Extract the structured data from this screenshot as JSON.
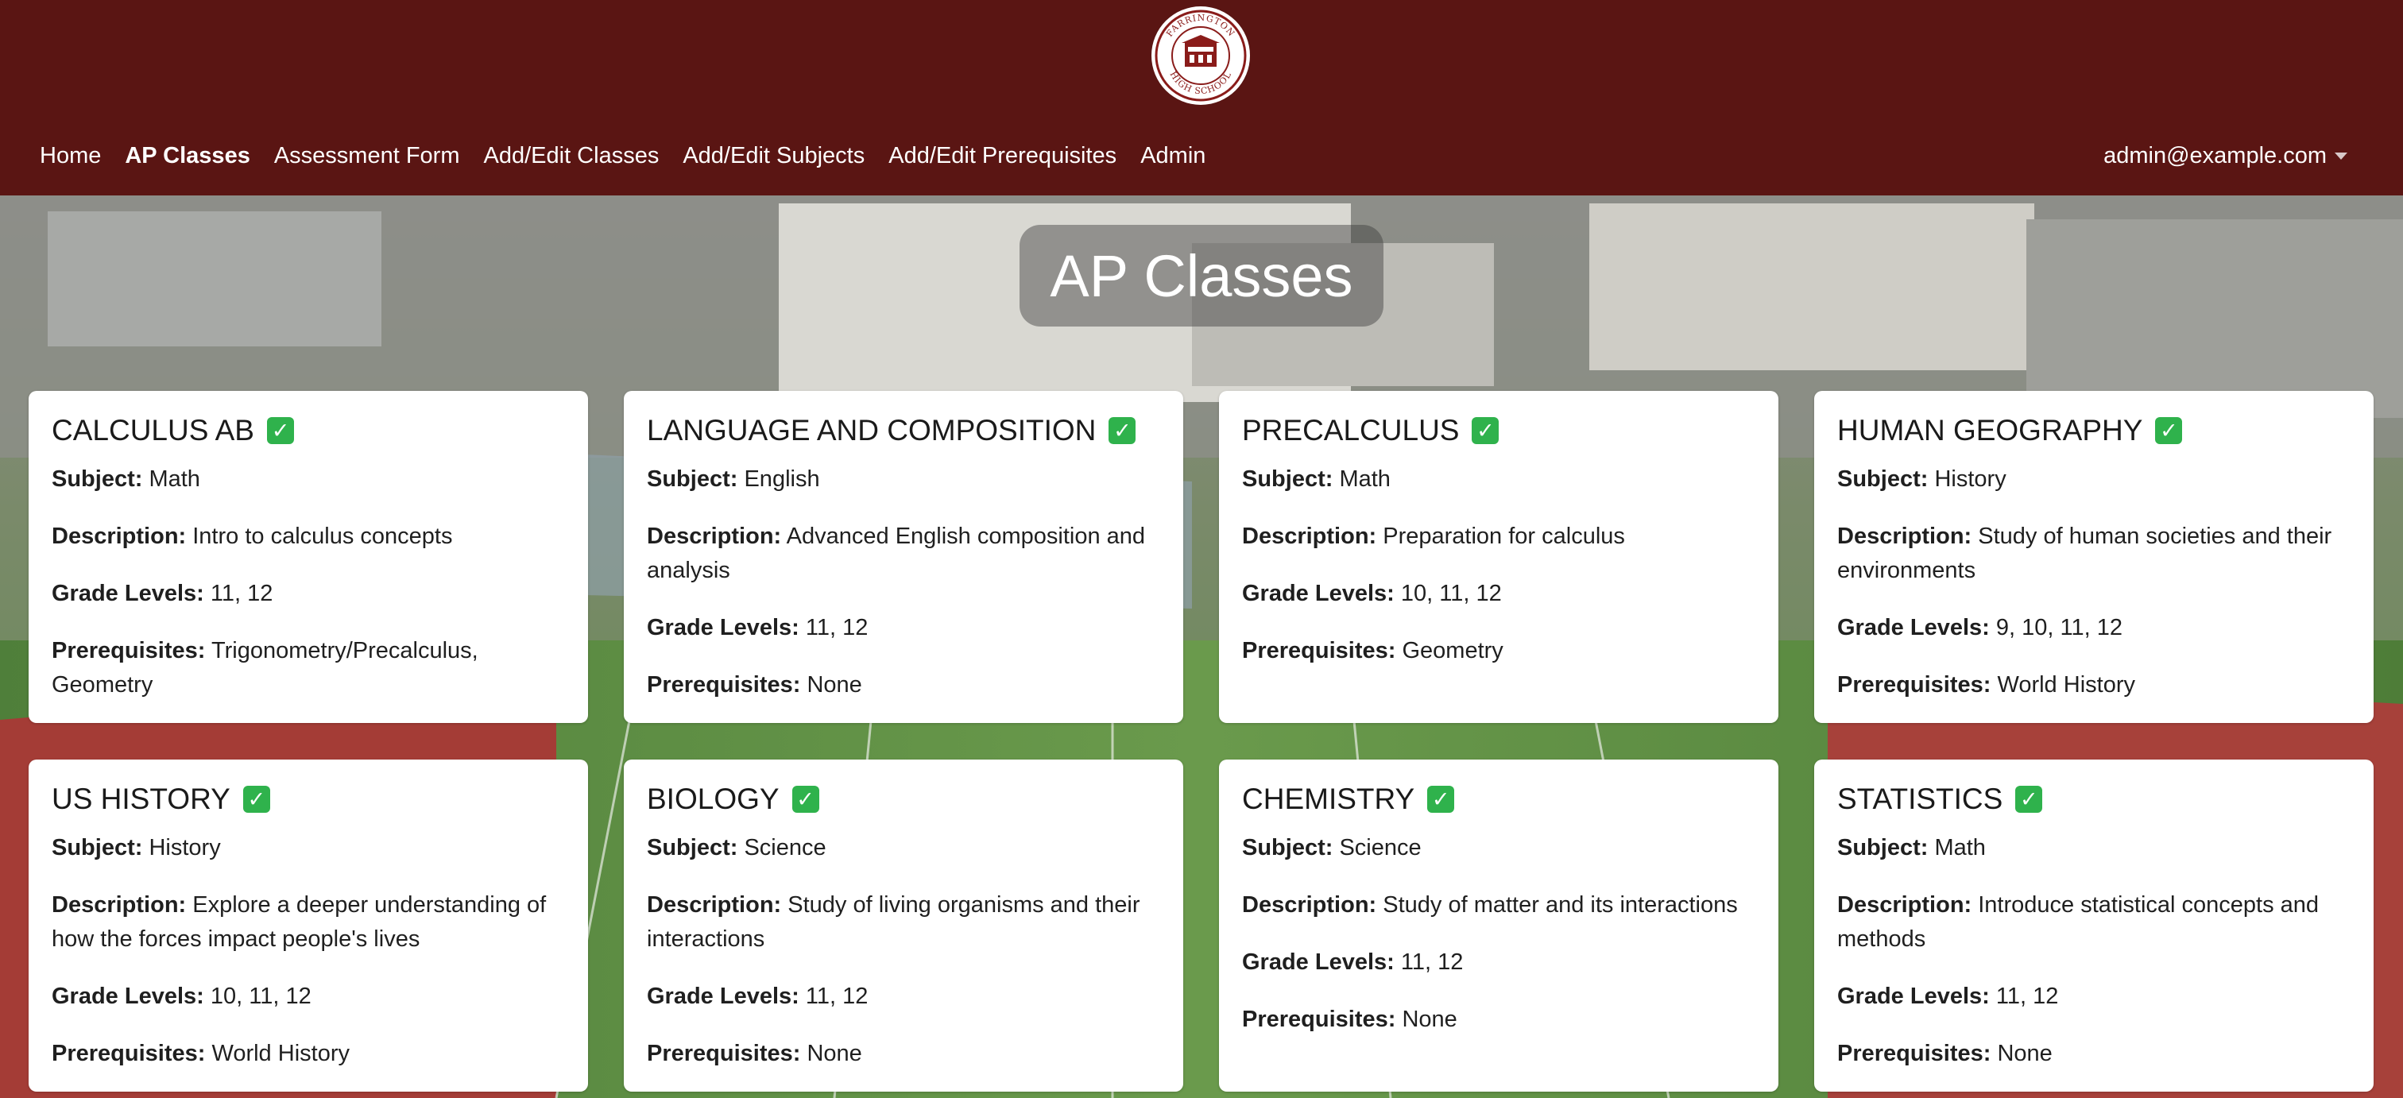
{
  "header": {
    "logo": {
      "top_text": "FARRINGTON",
      "bottom_text": "HIGH SCHOOL",
      "icon": "school-seal-icon"
    },
    "nav": [
      {
        "label": "Home",
        "active": false
      },
      {
        "label": "AP Classes",
        "active": true
      },
      {
        "label": "Assessment Form",
        "active": false
      },
      {
        "label": "Add/Edit Classes",
        "active": false
      },
      {
        "label": "Add/Edit Subjects",
        "active": false
      },
      {
        "label": "Add/Edit Prerequisites",
        "active": false
      },
      {
        "label": "Admin",
        "active": false
      }
    ],
    "user_email": "admin@example.com",
    "colors": {
      "bar": "#5a1513",
      "text": "#ffffff"
    }
  },
  "page": {
    "title": "AP Classes",
    "background": "aerial-campus-photo"
  },
  "labels": {
    "subject": "Subject:",
    "description": "Description:",
    "grade_levels": "Grade Levels:",
    "prerequisites": "Prerequisites:"
  },
  "check_icon": {
    "glyph": "✓",
    "color": "#2fb24c",
    "name": "check-mark-icon"
  },
  "classes": [
    {
      "name": "CALCULUS AB",
      "subject": "Math",
      "description": "Intro to calculus concepts",
      "grade_levels": "11, 12",
      "prerequisites": "Trigonometry/Precalculus, Geometry"
    },
    {
      "name": "LANGUAGE AND COMPOSITION",
      "subject": "English",
      "description": "Advanced English composition and analysis",
      "grade_levels": "11, 12",
      "prerequisites": "None"
    },
    {
      "name": "PRECALCULUS",
      "subject": "Math",
      "description": "Preparation for calculus",
      "grade_levels": "10, 11, 12",
      "prerequisites": "Geometry"
    },
    {
      "name": "HUMAN GEOGRAPHY",
      "subject": "History",
      "description": "Study of human societies and their environments",
      "grade_levels": "9, 10, 11, 12",
      "prerequisites": "World History"
    },
    {
      "name": "US HISTORY",
      "subject": "History",
      "description": "Explore a deeper understanding of how the forces impact people's lives",
      "grade_levels": "10, 11, 12",
      "prerequisites": "World History"
    },
    {
      "name": "BIOLOGY",
      "subject": "Science",
      "description": "Study of living organisms and their interactions",
      "grade_levels": "11, 12",
      "prerequisites": "None"
    },
    {
      "name": "CHEMISTRY",
      "subject": "Science",
      "description": "Study of matter and its interactions",
      "grade_levels": "11, 12",
      "prerequisites": "None"
    },
    {
      "name": "STATISTICS",
      "subject": "Math",
      "description": "Introduce statistical concepts and methods",
      "grade_levels": "11, 12",
      "prerequisites": "None"
    }
  ]
}
